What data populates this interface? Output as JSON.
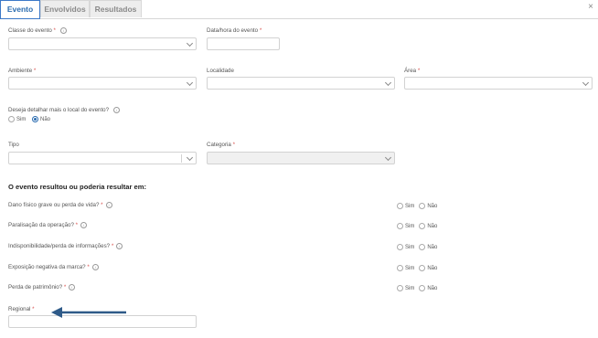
{
  "tabs": [
    {
      "label": "Evento"
    },
    {
      "label": "Envolvidos"
    },
    {
      "label": "Resultados"
    }
  ],
  "close_icon": "×",
  "fields": {
    "classe": {
      "label": "Classe do evento"
    },
    "data_hora": {
      "label": "Data/hora do evento"
    },
    "ambiente": {
      "label": "Ambiente"
    },
    "localidade": {
      "label": "Localidade"
    },
    "area": {
      "label": "Área"
    },
    "detalhar": {
      "label": "Deseja detalhar mais o local do evento?",
      "options": [
        "Sim",
        "Não"
      ],
      "selected": "Não"
    },
    "tipo": {
      "label": "Tipo"
    },
    "categoria": {
      "label": "Categoria"
    },
    "regional": {
      "label": "Regional"
    }
  },
  "section": {
    "title": "O evento resultou ou poderia resultar em:"
  },
  "questions": [
    {
      "label": "Dano físico grave ou perda de vida?"
    },
    {
      "label": "Paralisação da operação?"
    },
    {
      "label": "Indisponibilidade/perda de informações?"
    },
    {
      "label": "Exposição negativa da marca?"
    },
    {
      "label": "Perda de patrimônio?"
    }
  ],
  "yes_no": {
    "yes": "Sim",
    "no": "Não"
  },
  "required_mark": "*",
  "info_glyph": "i",
  "colors": {
    "accent": "#2b6cb0",
    "required": "#d9534f",
    "arrow": "#2e5a88"
  }
}
